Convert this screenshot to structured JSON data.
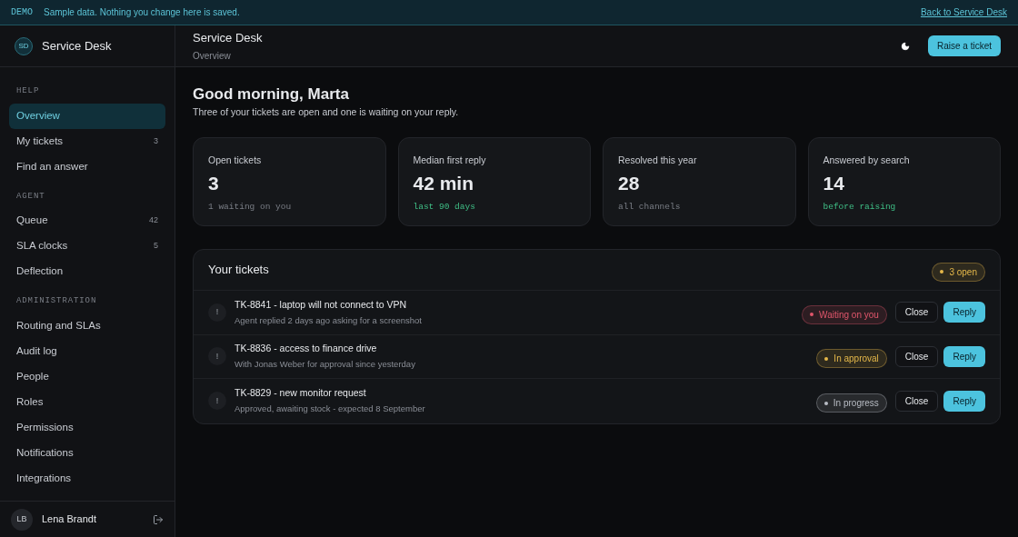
{
  "banner": {
    "tag": "DEMO",
    "message": "Sample data. Nothing you change here is saved.",
    "link": "Back to Service Desk"
  },
  "brand": {
    "initials": "SD",
    "name": "Service Desk"
  },
  "sidebar": {
    "sections": [
      {
        "label": "HELP",
        "items": [
          {
            "label": "Overview",
            "selected": true
          },
          {
            "label": "My tickets",
            "count": "3",
            "selected": false
          },
          {
            "label": "Find an answer",
            "selected": false
          }
        ]
      },
      {
        "label": "AGENT",
        "items": [
          {
            "label": "Queue",
            "count": "42",
            "selected": false
          },
          {
            "label": "SLA clocks",
            "count": "5",
            "selected": false
          },
          {
            "label": "Deflection",
            "selected": false
          }
        ]
      },
      {
        "label": "ADMINISTRATION",
        "items": [
          {
            "label": "Routing and SLAs",
            "selected": false
          },
          {
            "label": "Audit log",
            "selected": false
          },
          {
            "label": "People",
            "selected": false
          },
          {
            "label": "Roles",
            "selected": false
          },
          {
            "label": "Permissions",
            "selected": false
          },
          {
            "label": "Notifications",
            "selected": false
          },
          {
            "label": "Integrations",
            "selected": false
          }
        ]
      }
    ],
    "user": {
      "initials": "LB",
      "name": "Lena Brandt"
    }
  },
  "header": {
    "title": "Service Desk",
    "subtitle": "Overview",
    "action": "Raise a ticket"
  },
  "greeting": {
    "title": "Good morning, Marta",
    "text": "Three of your tickets are open and one is waiting on your reply."
  },
  "stats": [
    {
      "label": "Open tickets",
      "value": "3",
      "note": "1 waiting on you",
      "highlight": false
    },
    {
      "label": "Median first reply",
      "value": "42 min",
      "note": "last 90 days",
      "highlight": true
    },
    {
      "label": "Resolved this year",
      "value": "28",
      "note": "all channels",
      "highlight": false
    },
    {
      "label": "Answered by search",
      "value": "14",
      "note": "before raising",
      "highlight": true
    }
  ],
  "tickets": {
    "title": "Your tickets",
    "badge": {
      "label": "3 open",
      "color": "#e5b84a"
    },
    "rows": [
      {
        "mark": "!",
        "title": "TK-8841 - laptop will not connect to VPN",
        "detail": "Agent replied 2 days ago asking for a screenshot",
        "status": "Waiting on you",
        "color": "#e0566b",
        "close": "Close",
        "reply": "Reply"
      },
      {
        "mark": "!",
        "title": "TK-8836 - access to finance drive",
        "detail": "With Jonas Weber for approval since yesterday",
        "status": "In approval",
        "color": "#e5b84a",
        "close": "Close",
        "reply": "Reply"
      },
      {
        "mark": "!",
        "title": "TK-8829 - new monitor request",
        "detail": "Approved, awaiting stock - expected 8 September",
        "status": "In progress",
        "color": "#b8bcc4",
        "close": "Close",
        "reply": "Reply"
      }
    ]
  }
}
